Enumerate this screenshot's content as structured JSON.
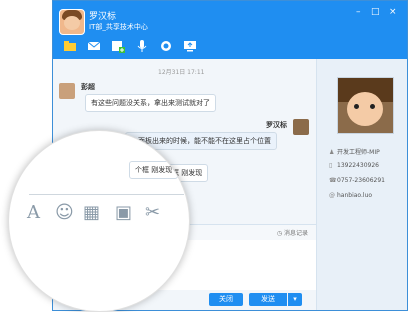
{
  "window": {
    "title_name": "罗汉标",
    "title_sub": "IT部_共享技术中心",
    "controls": [
      "–",
      "□",
      "×"
    ]
  },
  "toolbar": {
    "icons": [
      "folder-icon",
      "mail-icon",
      "add-contact-icon",
      "microphone-icon",
      "camera-icon",
      "screen-share-icon"
    ]
  },
  "chat": {
    "timestamp": "12月31日  17:11",
    "messages": [
      {
        "sender": "彭超",
        "text": "有这些问题没关系，拿出来测试就对了",
        "side": "left"
      },
      {
        "sender": "罗汉标",
        "text": "主面板出来的时候，能不能不在这里占个位置",
        "side": "right"
      }
    ],
    "partial_text": "个框    刚发现"
  },
  "input": {
    "history_label": "消息记录",
    "close_label": "关闭",
    "send_label": "发送",
    "send_dropdown": "▾"
  },
  "sidebar": {
    "title": "开发工程师-MIP",
    "phone": "13922430926",
    "tel": "0757-23606291",
    "email": "hanbiao.luo"
  },
  "magnifier": {
    "bubble_text": "个框    刚发现",
    "icons": [
      "font-icon",
      "emoji-icon",
      "screenshot-icon",
      "image-icon",
      "scissors-icon"
    ]
  }
}
